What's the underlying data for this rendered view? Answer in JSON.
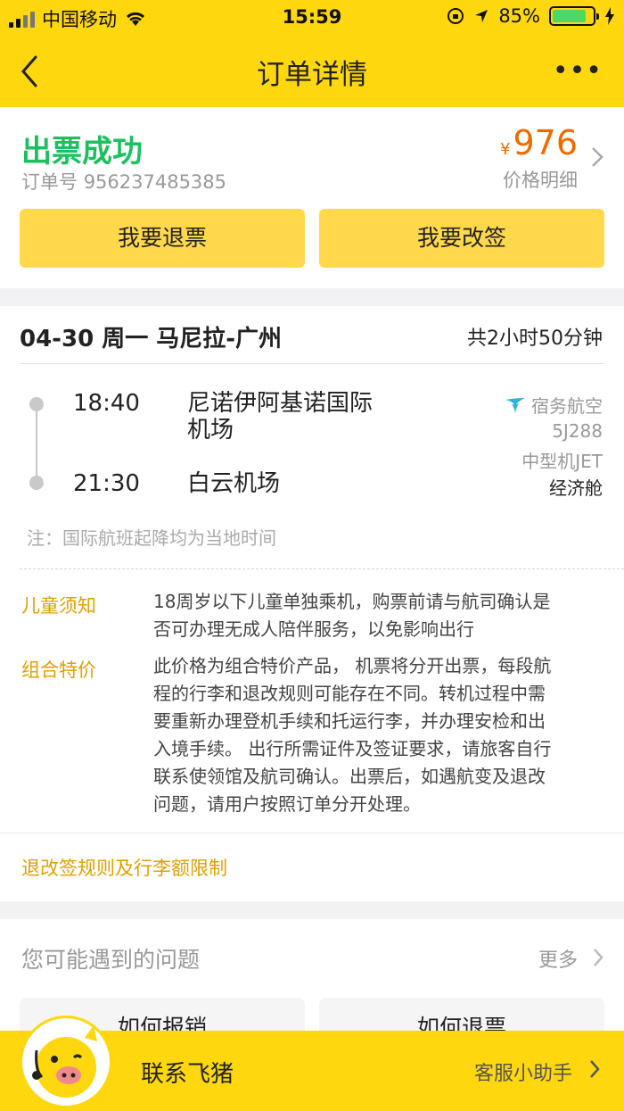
{
  "status_bar": {
    "carrier": "中国移动",
    "time": "15:59",
    "battery": "85%",
    "battery_level": 0.85
  },
  "nav": {
    "title": "订单详情",
    "more_label": "•••"
  },
  "order": {
    "status": "出票成功",
    "order_no_label": "订单号",
    "order_no": "956237485385",
    "currency": "¥",
    "price": "976",
    "price_detail_label": "价格明细",
    "refund_button": "我要退票",
    "change_button": "我要改签"
  },
  "flight": {
    "route": "04-30 周一 马尼拉-广州",
    "duration": "共2小时50分钟",
    "depart_time": "18:40",
    "depart_airport_line1": "尼诺伊阿基诺国际",
    "depart_airport_line2": "机场",
    "arrive_time": "21:30",
    "arrive_airport": "白云机场",
    "airline": "宿务航空",
    "flight_no": "5J288",
    "aircraft": "中型机JET",
    "cabin": "经济舱",
    "note": "注：国际航班起降均为当地时间"
  },
  "info": [
    {
      "label": "儿童须知",
      "lines": [
        "18周岁以下儿童单独乘机，购票前请与航司确认是",
        "否可办理无成人陪伴服务，以免影响出行"
      ]
    },
    {
      "label": "组合特价",
      "lines": [
        "此价格为组合特价产品， 机票将分开出票，每段航",
        "程的行李和退改规则可能存在不同。转机过程中需",
        "要重新办理登机手续和托运行李，并办理安检和出",
        "入境手续。 出行所需证件及签证要求，请旅客自行",
        "联系使领馆及航司确认。出票后，如遇航变及退改",
        "问题，请用户按照订单分开处理。"
      ]
    }
  ],
  "rules_link": "退改签规则及行李额限制",
  "faq": {
    "title": "您可能遇到的问题",
    "more": "更多",
    "items": [
      "如何报销",
      "如何退票"
    ]
  },
  "bottom": {
    "contact": "联系飞猪",
    "assistant": "客服小助手"
  },
  "colors": {
    "brand_yellow": "#ffd70f",
    "button_yellow": "#ffd84b",
    "success_green": "#1dc05e",
    "price_orange": "#f06a00",
    "label_amber": "#e0a000"
  }
}
